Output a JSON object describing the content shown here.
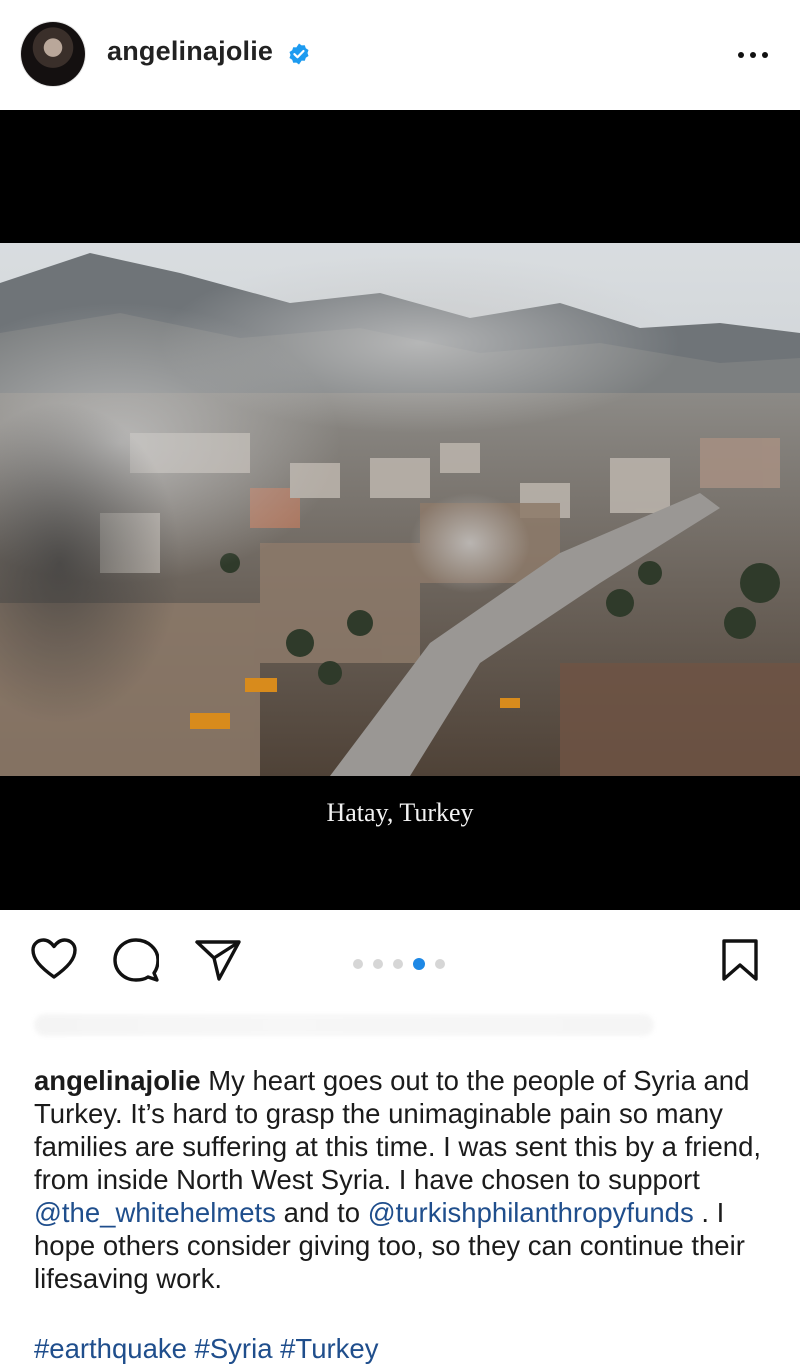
{
  "header": {
    "username": "angelinajolie",
    "verified_icon": "verified-badge-icon",
    "more_icon": "more-dots-icon"
  },
  "post": {
    "image_caption": "Hatay, Turkey",
    "carousel": {
      "count": 5,
      "active_index": 3
    }
  },
  "actions": {
    "like_icon": "heart-icon",
    "comment_icon": "comment-icon",
    "share_icon": "send-icon",
    "save_icon": "bookmark-icon"
  },
  "caption": {
    "username": "angelinajolie",
    "text_1": " My heart goes out to the people of Syria and Turkey. It’s hard to grasp the unimaginable pain so many families are suffering at this time. I was sent this by a friend, from inside North West Syria. I have chosen to support ",
    "mention_1": "@the_whitehelmets",
    "text_2": " and to ",
    "mention_2": "@turkishphilanthropyfunds",
    "text_3": " . I hope others consider giving too, so they can continue their lifesaving work.",
    "hashtags": "#earthquake #Syria #Turkey"
  },
  "colors": {
    "link": "#1f4e8c",
    "verified": "#1d9bf0",
    "carousel_active": "#1e88e5"
  }
}
